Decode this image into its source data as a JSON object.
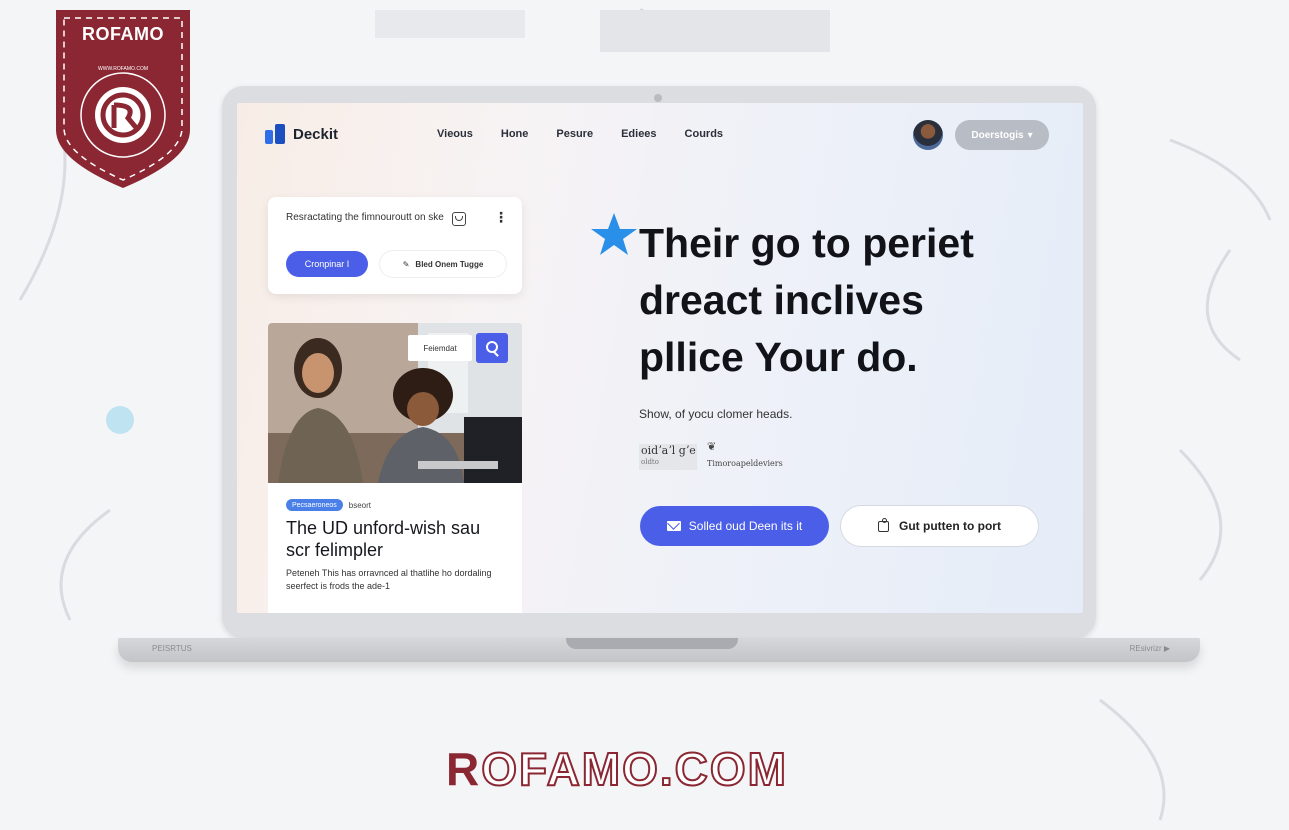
{
  "nav": {
    "brand": "Deckit",
    "links": [
      "Vieous",
      "Hone",
      "Pesure",
      "Ediees",
      "Courds"
    ],
    "dropdown_label": "Doerstogis",
    "dropdown_caret": "▾"
  },
  "card1": {
    "text": "Resractating the fimnouroutt on ske",
    "primary_label": "Cronpinar I",
    "secondary_label": "Bled Onem Tugge"
  },
  "card2": {
    "photo_tag": "Feiemdat",
    "badge": "Pecsaeroneos",
    "badge_extra": "bseort",
    "title": "The UD unford-wish sau scr felimpler",
    "description": "Peteneh This has orravnced al thatlihe ho dordaling seerfect is frods the ade-1"
  },
  "hero": {
    "title_lines": [
      "Their go to periet",
      "dreact inclives",
      "pllice Your do."
    ],
    "subtitle": "Show, of yocu clomer heads.",
    "sig_text": "oidʼaʼl gʼe",
    "sig_small": "oldto",
    "sig_mark": "❦",
    "sig_caption": "Timoroapeldeviers",
    "cta_primary": "Solled oud Deen its it",
    "cta_secondary": "Gut putten to port"
  },
  "laptop": {
    "base_left": "PEISRTUS",
    "base_right": "REsivrizr ▶"
  },
  "watermark": {
    "badge_title": "ROFAMO",
    "badge_ring_text": "WWW.ROFAMO.COM",
    "bottom_logo_r": "R",
    "bottom_logo_rest": "OFAMO.COM"
  },
  "colors": {
    "accent": "#4b5ee8",
    "brand_blue": "#2f6ee8",
    "watermark_maroon": "#8a2733",
    "star_blue": "#2a8fe8"
  }
}
